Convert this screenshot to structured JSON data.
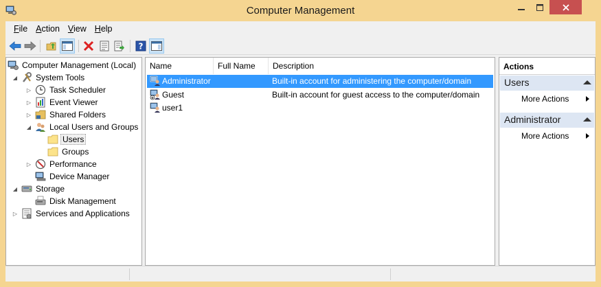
{
  "window": {
    "title": "Computer Management"
  },
  "menu": [
    {
      "label": "File",
      "accel": "F",
      "rest": "ile"
    },
    {
      "label": "Action",
      "accel": "A",
      "rest": "ction"
    },
    {
      "label": "View",
      "accel": "V",
      "rest": "iew"
    },
    {
      "label": "Help",
      "accel": "H",
      "rest": "elp"
    }
  ],
  "toolbar": {
    "buttons": [
      "back-arrow-icon",
      "forward-arrow-icon",
      "up-folder-icon",
      "show-hide-tree-icon",
      "delete-icon",
      "properties-icon",
      "export-list-icon",
      "help-icon",
      "show-hide-action-pane-icon"
    ]
  },
  "tree": {
    "root": "Computer Management (Local)",
    "system_tools": "System Tools",
    "task_scheduler": "Task Scheduler",
    "event_viewer": "Event Viewer",
    "shared_folders": "Shared Folders",
    "local_users_groups": "Local Users and Groups",
    "users": "Users",
    "groups": "Groups",
    "performance": "Performance",
    "device_manager": "Device Manager",
    "storage": "Storage",
    "disk_management": "Disk Management",
    "services_apps": "Services and Applications"
  },
  "list": {
    "columns": {
      "name": "Name",
      "full_name": "Full Name",
      "description": "Description"
    },
    "rows": [
      {
        "name": "Administrator",
        "full_name": "",
        "description": "Built-in account for administering the computer/domain",
        "selected": true
      },
      {
        "name": "Guest",
        "full_name": "",
        "description": "Built-in account for guest access to the computer/domain",
        "selected": false
      },
      {
        "name": "user1",
        "full_name": "",
        "description": "",
        "selected": false
      }
    ]
  },
  "actions": {
    "title": "Actions",
    "sections": [
      {
        "label": "Users",
        "item": "More Actions"
      },
      {
        "label": "Administrator",
        "item": "More Actions"
      }
    ]
  },
  "colors": {
    "selection": "#3399ff",
    "title_bar": "#f5d591",
    "close_button": "#c75050",
    "section_header": "#dde6f3"
  }
}
